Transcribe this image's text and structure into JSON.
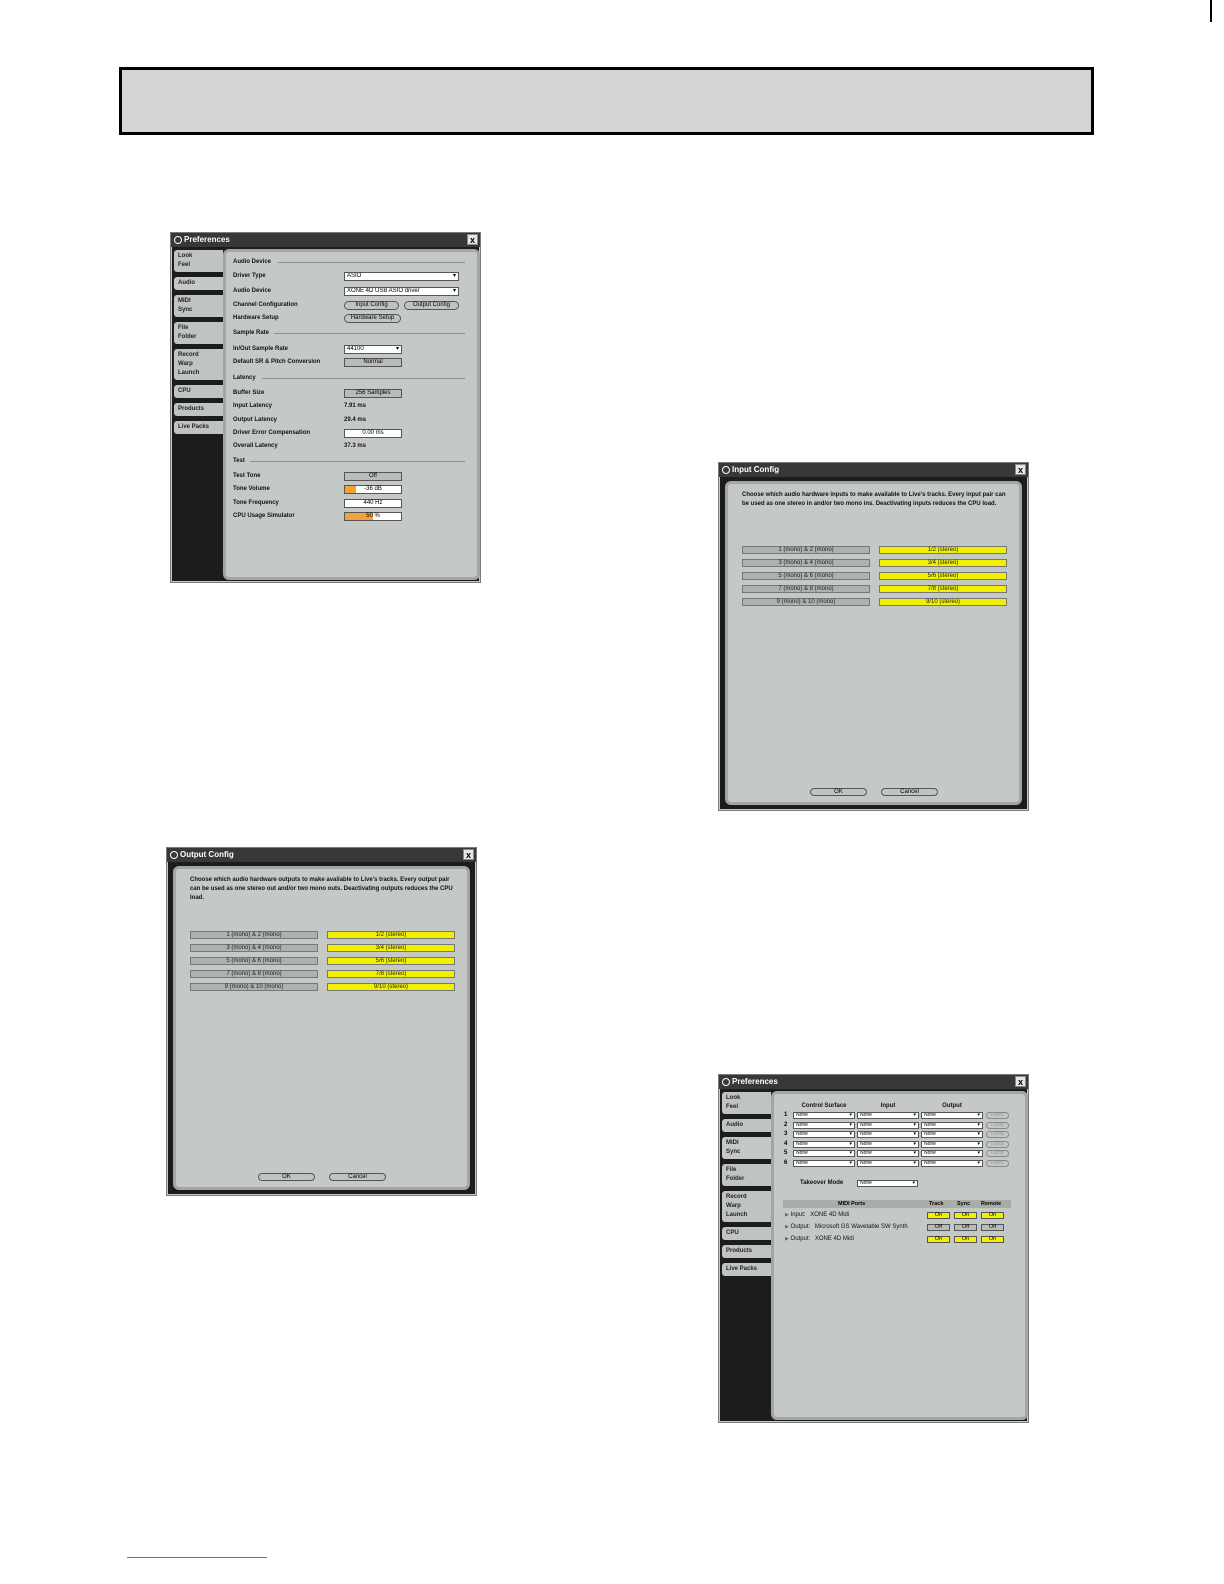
{
  "windows": {
    "audio_prefs": {
      "title": "Preferences",
      "close": "x",
      "tabs": [
        "Look\nFeel",
        "Audio",
        "MIDI\nSync",
        "File\nFolder",
        "Record\nWarp\nLaunch",
        "CPU",
        "Products",
        "Live Packs"
      ],
      "active_tab": "Audio",
      "sections": {
        "audio_device": "Audio Device",
        "sample_rate": "Sample Rate",
        "latency": "Latency",
        "test": "Test"
      },
      "driver_type": {
        "label": "Driver Type",
        "value": "ASIO"
      },
      "audio_device": {
        "label": "Audio Device",
        "value": "XONE 4D USB ASIO driver"
      },
      "channel_config": {
        "label": "Channel Configuration",
        "input_button": "Input Config",
        "output_button": "Output Config"
      },
      "hardware_setup": {
        "label": "Hardware Setup",
        "button": "Hardware Setup"
      },
      "in_out_rate": {
        "label": "In/Out Sample Rate",
        "value": "44100"
      },
      "default_sr": {
        "label": "Default SR & Pitch Conversion",
        "value": "Normal"
      },
      "buffer_size": {
        "label": "Buffer Size",
        "value": "256 Samples"
      },
      "input_latency": {
        "label": "Input Latency",
        "value": "7.91 ms"
      },
      "output_latency": {
        "label": "Output Latency",
        "value": "29.4 ms"
      },
      "driver_error": {
        "label": "Driver Error Compensation",
        "value": "0.00 ms"
      },
      "overall_latency": {
        "label": "Overall Latency",
        "value": "37.3 ms"
      },
      "test_tone": {
        "label": "Test Tone",
        "value": "Off"
      },
      "tone_volume": {
        "label": "Tone Volume",
        "value": "-36 dB",
        "level": 0.2
      },
      "tone_frequency": {
        "label": "Tone Frequency",
        "value": "440 Hz"
      },
      "cpu_sim": {
        "label": "CPU Usage Simulator",
        "value": "50 %",
        "level": 0.5
      }
    },
    "input_config": {
      "title": "Input Config",
      "close": "x",
      "description": "Choose which audio hardware inputs to make available to Live's tracks. Every input pair can be used as one stereo in and/or two mono ins. Deactivating inputs reduces the CPU load.",
      "mono": [
        "1 (mono) & 2 (mono)",
        "3 (mono) & 4 (mono)",
        "5 (mono) & 6 (mono)",
        "7 (mono) & 8 (mono)",
        "9 (mono) & 10 (mono)"
      ],
      "stereo": [
        "1/2 (stereo)",
        "3/4 (stereo)",
        "5/6 (stereo)",
        "7/8 (stereo)",
        "9/10 (stereo)"
      ],
      "ok": "OK",
      "cancel": "Cancel"
    },
    "output_config": {
      "title": "Output Config",
      "close": "x",
      "description": "Choose which audio hardware outputs to make available to Live's tracks. Every output pair can be used as one stereo out and/or two mono outs. Deactivating outputs reduces the CPU load.",
      "mono": [
        "1 (mono) & 2 (mono)",
        "3 (mono) & 4 (mono)",
        "5 (mono) & 6 (mono)",
        "7 (mono) & 8 (mono)",
        "9 (mono) & 10 (mono)"
      ],
      "stereo": [
        "1/2 (stereo)",
        "3/4 (stereo)",
        "5/6 (stereo)",
        "7/8 (stereo)",
        "9/10 (stereo)"
      ],
      "ok": "OK",
      "cancel": "Cancel"
    },
    "midi_prefs": {
      "title": "Preferences",
      "close": "x",
      "tabs": [
        "Look\nFeel",
        "Audio",
        "MIDI\nSync",
        "File\nFolder",
        "Record\nWarp\nLaunch",
        "CPU",
        "Products",
        "Live Packs"
      ],
      "active_tab": "MIDI\nSync",
      "headers": {
        "control_surface": "Control Surface",
        "input": "Input",
        "output": "Output"
      },
      "rows": [
        {
          "num": "1",
          "cs": "None",
          "in": "None",
          "out": "None",
          "dump": "Dump"
        },
        {
          "num": "2",
          "cs": "None",
          "in": "None",
          "out": "None",
          "dump": "Dump"
        },
        {
          "num": "3",
          "cs": "None",
          "in": "None",
          "out": "None",
          "dump": "Dump"
        },
        {
          "num": "4",
          "cs": "None",
          "in": "None",
          "out": "None",
          "dump": "Dump"
        },
        {
          "num": "5",
          "cs": "None",
          "in": "None",
          "out": "None",
          "dump": "Dump"
        },
        {
          "num": "6",
          "cs": "None",
          "in": "None",
          "out": "None",
          "dump": "Dump"
        }
      ],
      "takeover": {
        "label": "Takeover Mode",
        "value": "None"
      },
      "ports_header": {
        "ports": "MIDI Ports",
        "track": "Track",
        "sync": "Sync",
        "remote": "Remote"
      },
      "ports": [
        {
          "dir": "Input:",
          "name": "XONE 4D Midi",
          "track": "On",
          "sync": "On",
          "remote": "On"
        },
        {
          "dir": "Output:",
          "name": "Microsoft GS Wavetable SW Synth",
          "track": "Off",
          "sync": "Off",
          "remote": "Off"
        },
        {
          "dir": "Output:",
          "name": "XONE 4D Midi",
          "track": "On",
          "sync": "On",
          "remote": "On"
        }
      ]
    }
  }
}
